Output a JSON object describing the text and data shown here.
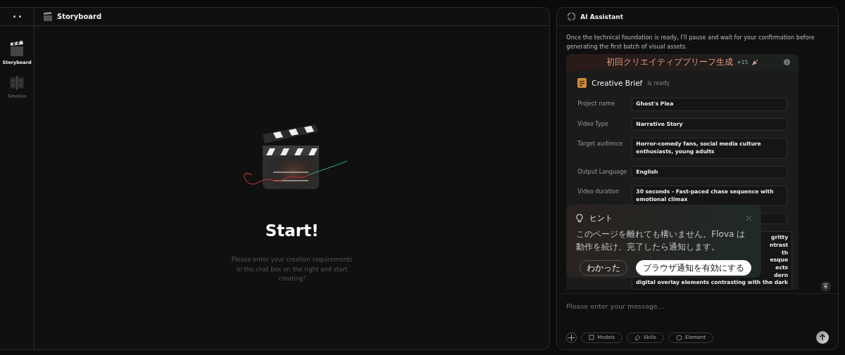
{
  "sidebar": {
    "items": [
      {
        "label": "Storyboard",
        "kind": "storyboard",
        "selected": true
      },
      {
        "label": "Timeline",
        "kind": "timeline",
        "selected": false
      }
    ]
  },
  "workspace": {
    "title": "Storyboard",
    "heading": "Start!",
    "hint": "Please enter your creation requirements in the chat box on the right and start creating!"
  },
  "assistant": {
    "title": "AI Assistant",
    "message": "Once the technical foundation is ready, I'll pause and wait for your confirmation before generating the first batch of visual assets.",
    "reward": {
      "label": "初回クリエイティブブリーフ生成",
      "points": "+15"
    },
    "brief": {
      "title": "Creative Brief",
      "status": "is ready",
      "fields": [
        {
          "label": "Project name",
          "value": "Ghost's Plea"
        },
        {
          "label": "Video Type",
          "value": "Narrative Story"
        },
        {
          "label": "Target audience",
          "value": "Horror-comedy fans, social media culture enthusiasts, young adults"
        },
        {
          "label": "Output Language",
          "value": "English"
        },
        {
          "label": "Video duration",
          "value": "30 seconds - Fast-paced chase sequence with emotional climax"
        }
      ],
      "covered_lines": [
        "gritty",
        "ntrast",
        "th",
        "esque",
        "ects",
        "dern",
        "digital overlay elements contrasting with the dark"
      ]
    },
    "input": {
      "placeholder": "Please enter your message..."
    },
    "chips": [
      {
        "label": "Models",
        "kind": "models"
      },
      {
        "label": "Skills",
        "kind": "skills"
      },
      {
        "label": "Element",
        "kind": "element"
      }
    ]
  },
  "tip": {
    "title": "ヒント",
    "text": "このページを離れても構いません。Flova は動作を続け、完了したら通知します。",
    "buttons": [
      {
        "label": "わかった",
        "kind": "secondary"
      },
      {
        "label": "ブラウザ通知を有効にする",
        "kind": "primary"
      }
    ]
  }
}
